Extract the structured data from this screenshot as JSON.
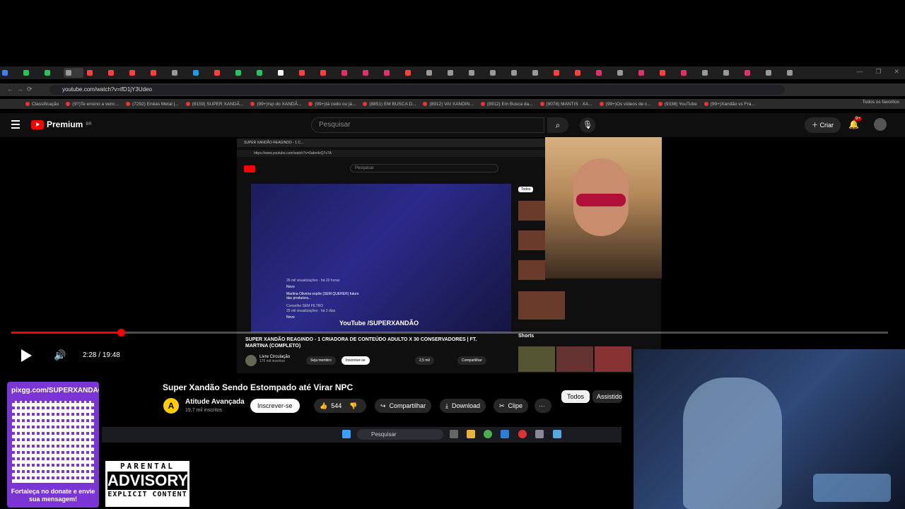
{
  "browser": {
    "url": "youtube.com/watch?v=ifD1jY3Udeo",
    "bookmarks": [
      "Classificação",
      "(9?)Te ensino a venc...",
      "(7292) Enéas Metal |...",
      "(8159) SUPER XANDÃ...",
      "(99+)rsp do XANDÃ...",
      "(99+)tá cedo ou já...",
      "(8851) EM BUSCA D...",
      "(8912) VAI XANDIN...",
      "(8912) Em Busca da...",
      "(9078) MANTIS · XA...",
      "(99+)Os vídeos de c...",
      "(9338) YouTube",
      "(99+)Xandão vs Fra..."
    ],
    "all_favorites": "Todos os favoritos"
  },
  "youtube": {
    "brand": "Premium",
    "region": "BR",
    "search_placeholder": "Pesquisar",
    "create_label": "Criar",
    "notif_count": "9+"
  },
  "inner_video": {
    "tab_title": "SUPER XANDÃO REAGINDO - 1 C...",
    "url": "https://www.youtube.com/watch?v=0abn4zQ7x7A",
    "search_placeholder": "Pesquisar",
    "watermark": "YouTube /SUPERXANDÃO",
    "title": "SUPER XANDÃO REAGINDO - 1 CRIADORA DE CONTEÚDO ADULTO X 30 CONSERVADORES | FT. MARTINA (COMPLETO)",
    "channel": "Livre Circulação",
    "subs": "170 mil inscritos",
    "member_btn": "Seja membro",
    "subscribe_btn": "Inscrever-se",
    "likes": "2,5 mil",
    "share": "Compartilhar",
    "chip_all": "Todos",
    "sidebar": [
      {
        "text": "26 mil visualizações · há 20 horas",
        "badge": "Novo"
      },
      {
        "text": "Martina Oliveira expõe (SEM QUERER) futuro das produtora...",
        "sub": "Conselho SEM FILTRO",
        "meta": "25 mil visualizações · há 2 dias",
        "badge": "Novo"
      }
    ],
    "shorts": "Shorts"
  },
  "player": {
    "current_time": "2:28",
    "duration": "19:48",
    "progress": 0.1246
  },
  "video": {
    "title": "Super Xandão Sendo Estompado até Virar NPC",
    "channel": "Atitude Avançada",
    "subs": "19,7 mil inscritos",
    "subscribe": "Inscrever-se",
    "likes": "544",
    "share": "Compartilhar",
    "download": "Download",
    "clip": "Clipe",
    "more": "···"
  },
  "chips": [
    "Todos",
    "Assistidos"
  ],
  "overlay": {
    "qr_url": "pixgg.com/SUPERXANDÃO",
    "qr_message": "Fortaleça no donate e envie sua mensagem!",
    "advisory_top": "PARENTAL",
    "advisory_mid": "ADVISORY",
    "advisory_bottom": "EXPLICIT CONTENT"
  },
  "taskbar": {
    "search": "Pesquisar"
  },
  "colors": {
    "yt_red": "#ff0000",
    "qr_purple": "#7b35d4",
    "bg": "#0f0f0f"
  }
}
